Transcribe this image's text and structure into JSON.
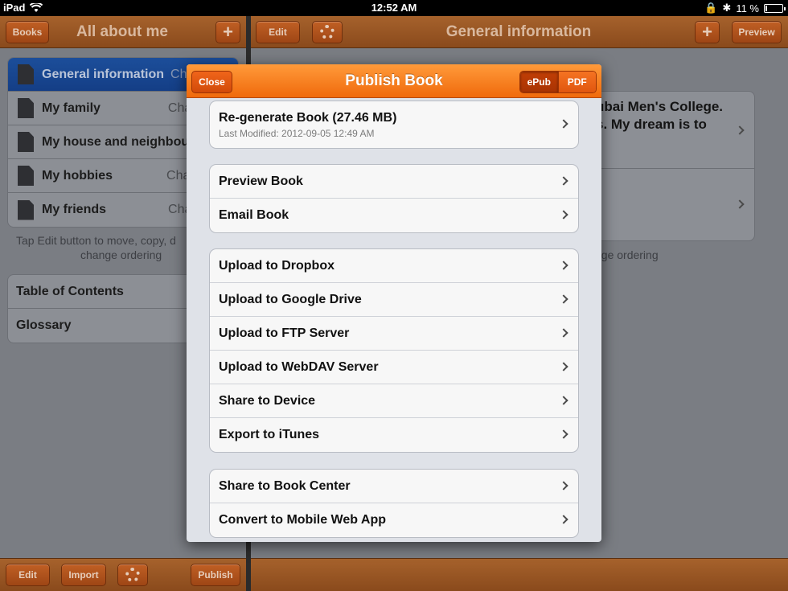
{
  "status_bar": {
    "device": "iPad",
    "time": "12:52 AM",
    "battery": "11 %",
    "battery_level": 0.11
  },
  "left_panel": {
    "title": "All about me",
    "books_button": "Books",
    "add_button": "+",
    "chapters": [
      {
        "title": "General information",
        "sub": "Ch",
        "selected": true
      },
      {
        "title": "My family",
        "sub": "Cha"
      },
      {
        "title": "My house and neighbou",
        "sub": ""
      },
      {
        "title": "My hobbies",
        "sub": "Cha"
      },
      {
        "title": "My friends",
        "sub": "Cha"
      }
    ],
    "hint": "Tap Edit button to move, copy, d",
    "hint_line2": "change ordering",
    "extras": [
      "Table of Contents",
      "Glossary"
    ],
    "bottom_buttons": {
      "edit": "Edit",
      "import": "Import",
      "publish": "Publish"
    }
  },
  "right_panel": {
    "title": "General information",
    "edit_button": "Edit",
    "add_button": "+",
    "preview_button": "Preview",
    "content_line1": "ubai Men's College.",
    "content_line2": "s. My dream is to",
    "hint": "nge ordering"
  },
  "modal": {
    "title": "Publish Book",
    "close_button": "Close",
    "format_epub": "ePub",
    "format_pdf": "PDF",
    "regenerate_title": "Re-generate Book (27.46 MB)",
    "regenerate_sub": "Last Modified: 2012-09-05 12:49 AM",
    "group_preview": [
      "Preview Book",
      "Email Book"
    ],
    "group_upload": [
      "Upload to Dropbox",
      "Upload to Google Drive",
      "Upload to FTP Server",
      "Upload to WebDAV Server",
      "Share to Device",
      "Export to iTunes"
    ],
    "group_share": [
      "Share to Book Center",
      "Convert to Mobile Web App"
    ]
  }
}
